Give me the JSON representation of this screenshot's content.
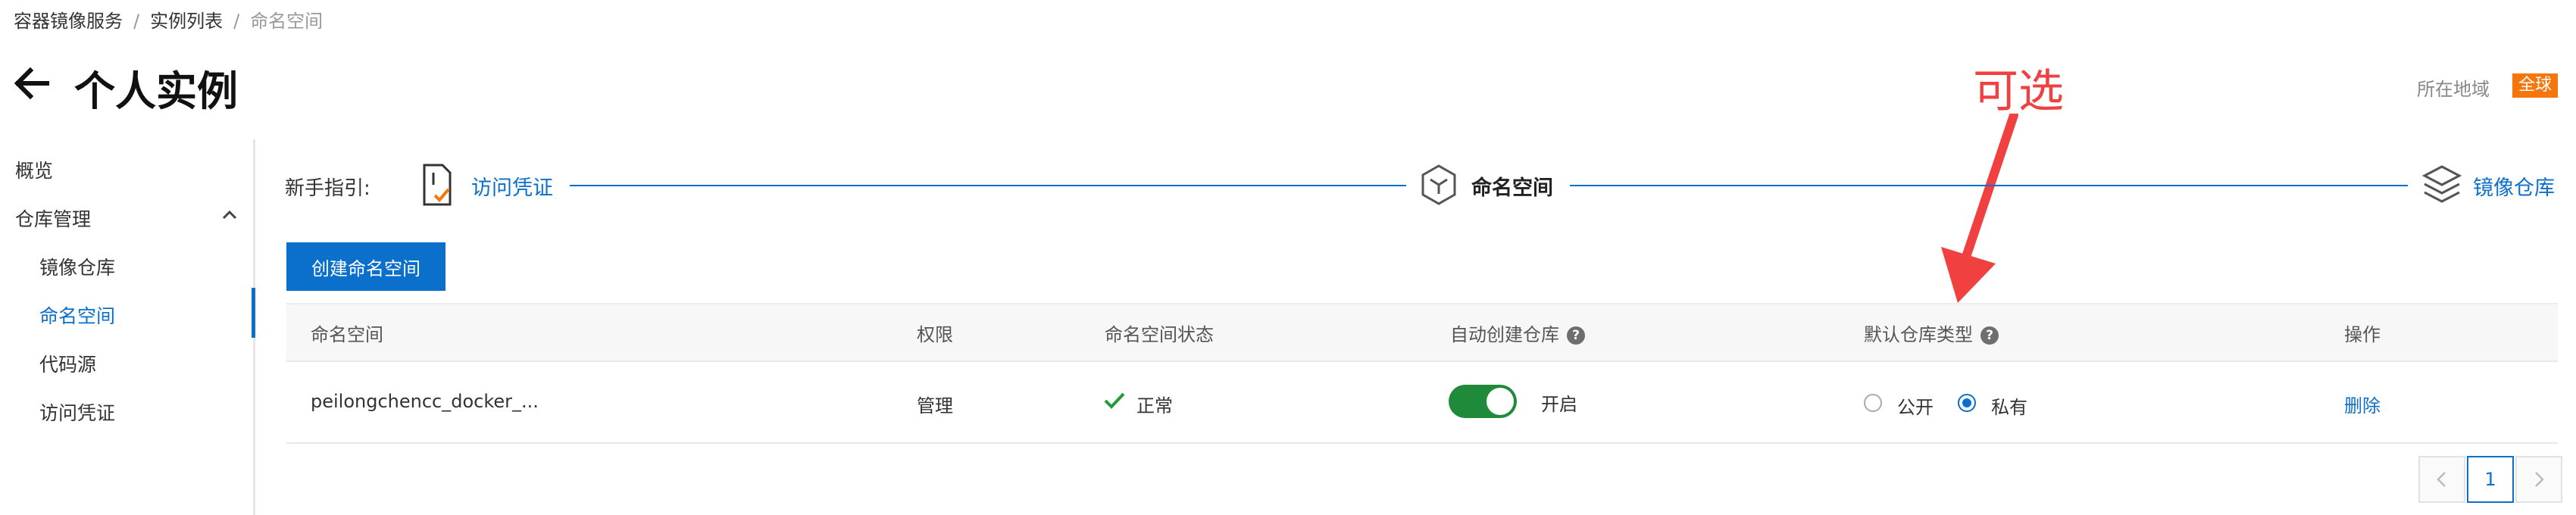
{
  "breadcrumb": {
    "items": [
      "容器镜像服务",
      "实例列表",
      "命名空间"
    ],
    "separator": "/"
  },
  "header": {
    "back_icon": "arrow-left-icon",
    "title": "个人实例",
    "region_label": "所在地域",
    "region_value": "全球"
  },
  "annotation": {
    "text": "可选",
    "color": "#f04040"
  },
  "sidebar": {
    "items": [
      {
        "label": "概览"
      },
      {
        "label": "仓库管理"
      },
      {
        "label": "镜像仓库"
      },
      {
        "label": "命名空间",
        "active": true
      },
      {
        "label": "代码源"
      },
      {
        "label": "访问凭证"
      }
    ]
  },
  "guide": {
    "label": "新手指引:",
    "steps": [
      {
        "label": "访问凭证",
        "icon": "document-check-icon",
        "state": "link"
      },
      {
        "label": "命名空间",
        "icon": "cube-icon",
        "state": "current"
      },
      {
        "label": "镜像仓库",
        "icon": "layers-icon",
        "state": "link"
      }
    ]
  },
  "actions": {
    "create_label": "创建命名空间"
  },
  "table": {
    "columns": [
      "命名空间",
      "权限",
      "命名空间状态",
      "自动创建仓库",
      "默认仓库类型",
      "操作"
    ],
    "rows": [
      {
        "namespace": "peilongchencc_docker_...",
        "permission": "管理",
        "status": "正常",
        "auto_create": {
          "on": true,
          "label": "开启"
        },
        "repo_type": {
          "options": [
            "公开",
            "私有"
          ],
          "selected": "私有"
        },
        "action": "删除"
      }
    ]
  },
  "pagination": {
    "current": "1"
  },
  "colors": {
    "accent": "#0b6fcc",
    "toggle_on": "#1f8b3a",
    "region_badge": "#f5760d",
    "success": "#1f9d3a"
  }
}
